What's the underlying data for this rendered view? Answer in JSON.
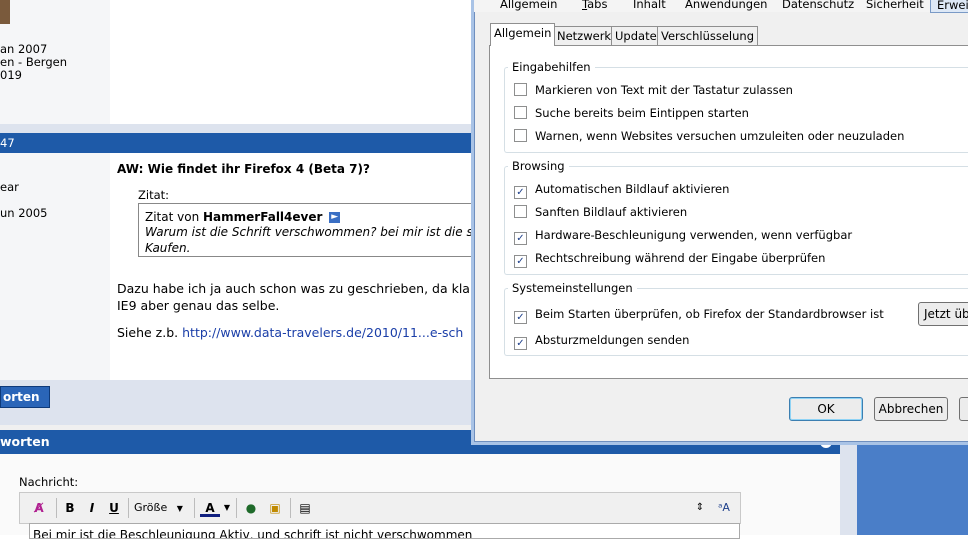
{
  "forum": {
    "post1_meta": [
      "an 2007",
      "en - Bergen",
      "019"
    ],
    "post2_number": "47",
    "post2_meta": [
      "ear",
      "un 2005"
    ],
    "post_title": "AW: Wie findet ihr Firefox 4 (Beta 7)?",
    "quote_label": "Zitat:",
    "quote_prefix": "Zitat von",
    "quote_author": "HammerFall4ever",
    "quote_text": "Warum ist die Schrift verschwommen? bei mir ist die s Kaufen.",
    "body_line1": "Dazu habe ich ja auch schon was zu geschrieben, da kla IE9 aber genau das selbe.",
    "body_see": "Siehe z.b.",
    "body_link": "http://www.data-travelers.de/2010/11...e-sch",
    "reply_button": "orten",
    "reply_panel_title": "worten",
    "message_label": "Nachricht:",
    "editor_text": "Bei mir ist die Beschleunigung Aktiv, und schrift ist nicht verschwommen",
    "toolbar": {
      "bold": "B",
      "italic": "I",
      "underline": "U",
      "size": "Größe"
    }
  },
  "dialog": {
    "top_tabs": [
      "Allgemein",
      "Tabs",
      "Inhalt",
      "Anwendungen",
      "Datenschutz",
      "Sicherheit",
      "Erweit"
    ],
    "sub_tabs": [
      "Allgemein",
      "Netzwerk",
      "Update",
      "Verschlüsselung"
    ],
    "groups": {
      "accessibility": {
        "title": "Eingabehilfen",
        "options": [
          {
            "label": "Markieren von Text mit der Tastatur zulassen",
            "checked": false
          },
          {
            "label": "Suche bereits beim Eintippen starten",
            "checked": false
          },
          {
            "label": "Warnen, wenn Websites versuchen umzuleiten oder neuzuladen",
            "checked": false
          }
        ]
      },
      "browsing": {
        "title": "Browsing",
        "options": [
          {
            "label": "Automatischen Bildlauf aktivieren",
            "checked": true
          },
          {
            "label": "Sanften Bildlauf aktivieren",
            "checked": false
          },
          {
            "label": "Hardware-Beschleunigung verwenden, wenn verfügbar",
            "checked": true
          },
          {
            "label": "Rechtschreibung während der Eingabe überprüfen",
            "checked": true
          }
        ]
      },
      "system": {
        "title": "Systemeinstellungen",
        "options": [
          {
            "label": "Beim Starten überprüfen, ob Firefox der Standardbrowser ist",
            "checked": true
          },
          {
            "label": "Absturzmeldungen senden",
            "checked": true
          }
        ],
        "check_now_button": "Jetzt übe"
      }
    },
    "buttons": {
      "ok": "OK",
      "cancel": "Abbrechen"
    }
  },
  "colors": {
    "forum_header": "#1e5aa8",
    "dialog_bg": "#f0f0f0",
    "dialog_border": "#6f8fbf"
  }
}
